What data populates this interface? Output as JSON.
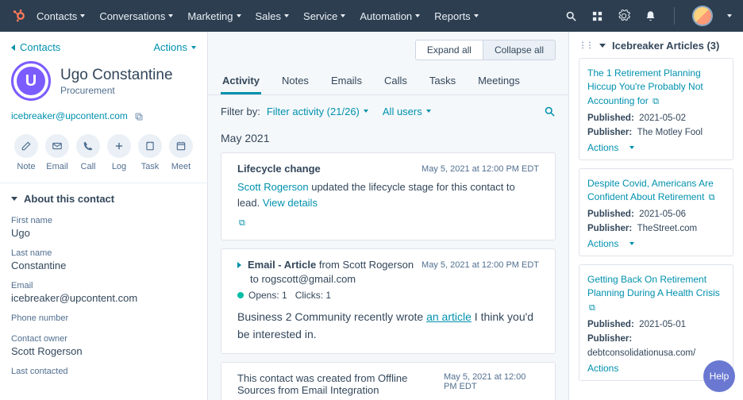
{
  "nav": {
    "items": [
      "Contacts",
      "Conversations",
      "Marketing",
      "Sales",
      "Service",
      "Automation",
      "Reports"
    ]
  },
  "left": {
    "back_label": "Contacts",
    "actions_label": "Actions",
    "contact_name": "Ugo Constantine",
    "contact_initial": "U",
    "role": "Procurement",
    "email": "icebreaker@upcontent.com",
    "action_buttons": [
      {
        "label": "Note",
        "icon": "note"
      },
      {
        "label": "Email",
        "icon": "email"
      },
      {
        "label": "Call",
        "icon": "call"
      },
      {
        "label": "Log",
        "icon": "log"
      },
      {
        "label": "Task",
        "icon": "task"
      },
      {
        "label": "Meet",
        "icon": "meet"
      }
    ],
    "about_header": "About this contact",
    "fields": [
      {
        "label": "First name",
        "value": "Ugo"
      },
      {
        "label": "Last name",
        "value": "Constantine"
      },
      {
        "label": "Email",
        "value": "icebreaker@upcontent.com"
      },
      {
        "label": "Phone number",
        "value": ""
      },
      {
        "label": "Contact owner",
        "value": "Scott Rogerson"
      },
      {
        "label": "Last contacted",
        "value": ""
      }
    ]
  },
  "mid": {
    "expand": "Expand all",
    "collapse": "Collapse all",
    "tabs": [
      "Activity",
      "Notes",
      "Emails",
      "Calls",
      "Tasks",
      "Meetings"
    ],
    "filter_label": "Filter by:",
    "filter_activity": "Filter activity (21/26)",
    "all_users": "All users",
    "month": "May 2021",
    "card1": {
      "title": "Lifecycle change",
      "date": "May 5, 2021 at 12:00 PM EDT",
      "actor": "Scott Rogerson",
      "text": " updated the lifecycle stage for this contact to lead. ",
      "link": "View details"
    },
    "card2": {
      "title_bold": "Email - Article",
      "title_rest": " from Scott Rogerson",
      "date": "May 5, 2021 at 12:00 PM EDT",
      "to_line": "to rogscott@gmail.com",
      "opens_label": "Opens: 1",
      "clicks_label": "Clicks: 1",
      "body_pre": "Business 2 Community recently wrote ",
      "body_link": "an article",
      "body_post": " I think you'd be interested in."
    },
    "card3": {
      "text": "This contact was created from Offline Sources from Email Integration",
      "date": "May 5, 2021 at 12:00 PM EDT"
    }
  },
  "right": {
    "header": "Icebreaker Articles (3)",
    "actions_label": "Actions",
    "articles": [
      {
        "title": "The 1 Retirement Planning Hiccup You're Probably Not Accounting for",
        "published": "2021-05-02",
        "publisher": "The Motley Fool"
      },
      {
        "title": "Despite Covid, Americans Are Confident About Retirement",
        "published": "2021-05-06",
        "publisher": "TheStreet.com"
      },
      {
        "title": "Getting Back On Retirement Planning During A Health Crisis",
        "published": "2021-05-01",
        "publisher": "debtconsolidationusa.com/"
      }
    ],
    "pub_label": "Published:",
    "publisher_label": "Publisher:",
    "help": "Help"
  }
}
